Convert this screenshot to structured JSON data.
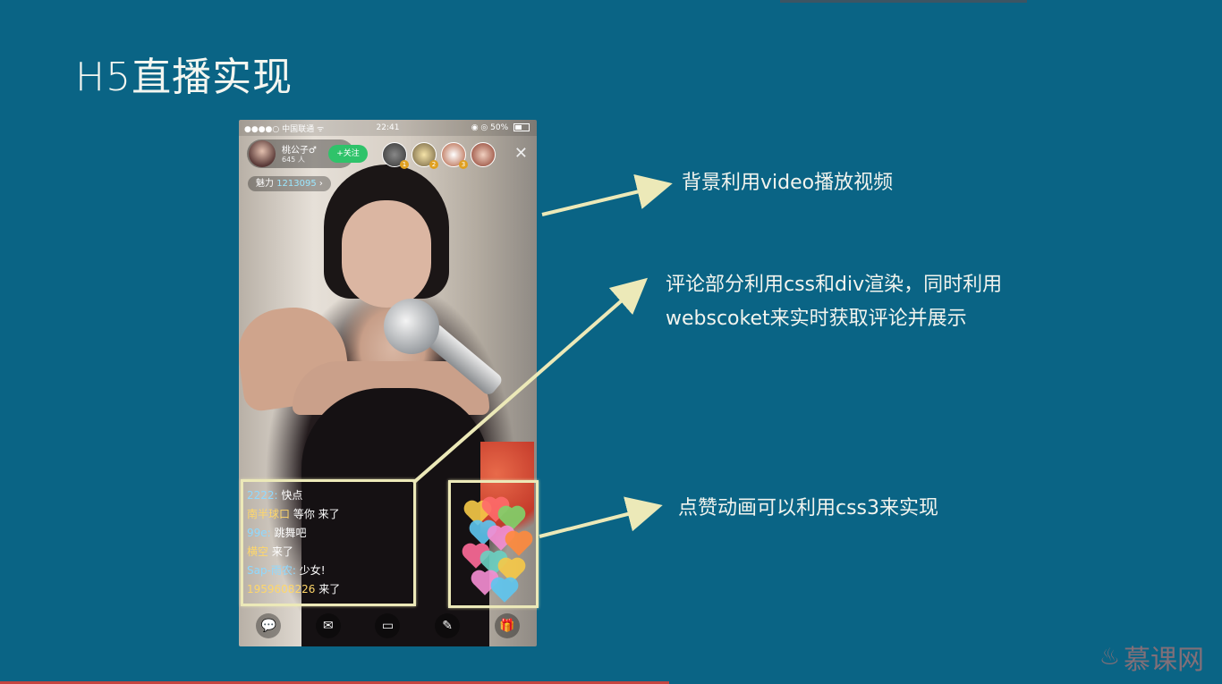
{
  "slide": {
    "title": "H5直播实现"
  },
  "phone": {
    "status": {
      "carrier": "●●●●○ 中国联通 ᯤ",
      "time": "22:41",
      "battery": "◉ ◎ 50%"
    },
    "host": {
      "name": "桃公子♂",
      "viewers": "645 人",
      "follow_label": "+关注"
    },
    "viewer_badges": [
      "1",
      "2",
      "3"
    ],
    "charm": {
      "label": "魅力",
      "value": "1213095",
      "chevron": "›"
    },
    "comments": [
      {
        "user": "2222:",
        "text": "快点",
        "user_color": "blue"
      },
      {
        "user": "南半球口",
        "text": "等你 来了",
        "user_color": "yellow"
      },
      {
        "user": "99e:",
        "text": "跳舞吧",
        "user_color": "blue"
      },
      {
        "user": "横空",
        "text": "来了",
        "user_color": "yellow"
      },
      {
        "user": "Sap-雨农:",
        "text": "少女!",
        "user_color": "blue"
      },
      {
        "user": "1959608226",
        "text": "来了",
        "user_color": "yellow"
      }
    ],
    "toolbar": {
      "chat_icon": "chat-bubble-icon",
      "message_icon": "envelope-icon",
      "video_icon": "camera-icon",
      "share_icon": "share-icon",
      "gift_icon": "gift-icon"
    }
  },
  "annotations": {
    "video": "背景利用video播放视频",
    "comments_line1": "评论部分利用css和div渲染，同时利用",
    "comments_line2": "webscoket来实时获取评论并展示",
    "likes": "点赞动画可以利用css3来实现"
  },
  "watermark": {
    "text": "慕课网"
  },
  "colors": {
    "background": "#0a6485",
    "annotation": "#ece9b8",
    "follow_button": "#2fc36a",
    "progress": "#c64440"
  }
}
